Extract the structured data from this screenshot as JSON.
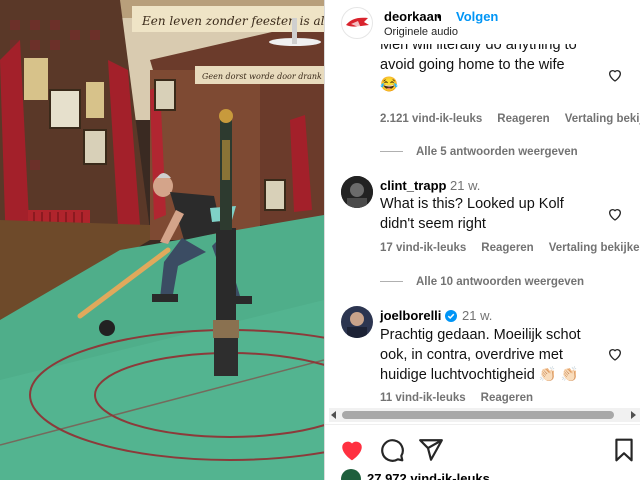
{
  "header": {
    "account": "deorkaan",
    "separator": "•",
    "follow_label": "Volgen",
    "audio": "Originele audio"
  },
  "media": {
    "banner_top": "Een leven zonder feesten is als een",
    "banner_mid": "Geen dorst worde door drank"
  },
  "comments": [
    {
      "text_line1": "Men will literally do anything to",
      "text_line2": "avoid going home to the wife",
      "emoji": "😂",
      "likes": "2.121 vind-ik-leuks",
      "reply": "Reageren",
      "translate": "Vertaling bekijken",
      "replies": "Alle 5 antwoorden weergeven"
    },
    {
      "user": "clint_trapp",
      "ago": "21 w.",
      "text_line1": "What is this? Looked up Kolf",
      "text_line2": "didn't seem right",
      "likes": "17 vind-ik-leuks",
      "reply": "Reageren",
      "translate": "Vertaling bekijken",
      "replies": "Alle 10 antwoorden weergeven"
    },
    {
      "user": "joelborelli",
      "ago": "21 w.",
      "text_line1": "Prachtig gedaan. Moeilijk schot",
      "text_line2": "ook, in contra, overdrive met",
      "text_line3": "huidige luchtvochtigheid",
      "emoji": "👏🏻 👏🏻",
      "likes": "11 vind-ik-leuks",
      "reply": "Reageren"
    }
  ],
  "footer": {
    "likes": "27.972 vind-ik-leuks"
  },
  "colors": {
    "link_blue": "#0095f6",
    "like_red": "#ff3040",
    "muted": "#737373",
    "floor_green": "#4fae8a",
    "wall_red": "#a3202a"
  },
  "icons": [
    "heart-filled-icon",
    "comment-icon",
    "share-icon",
    "bookmark-icon",
    "verified-icon",
    "heart-outline-icon"
  ]
}
